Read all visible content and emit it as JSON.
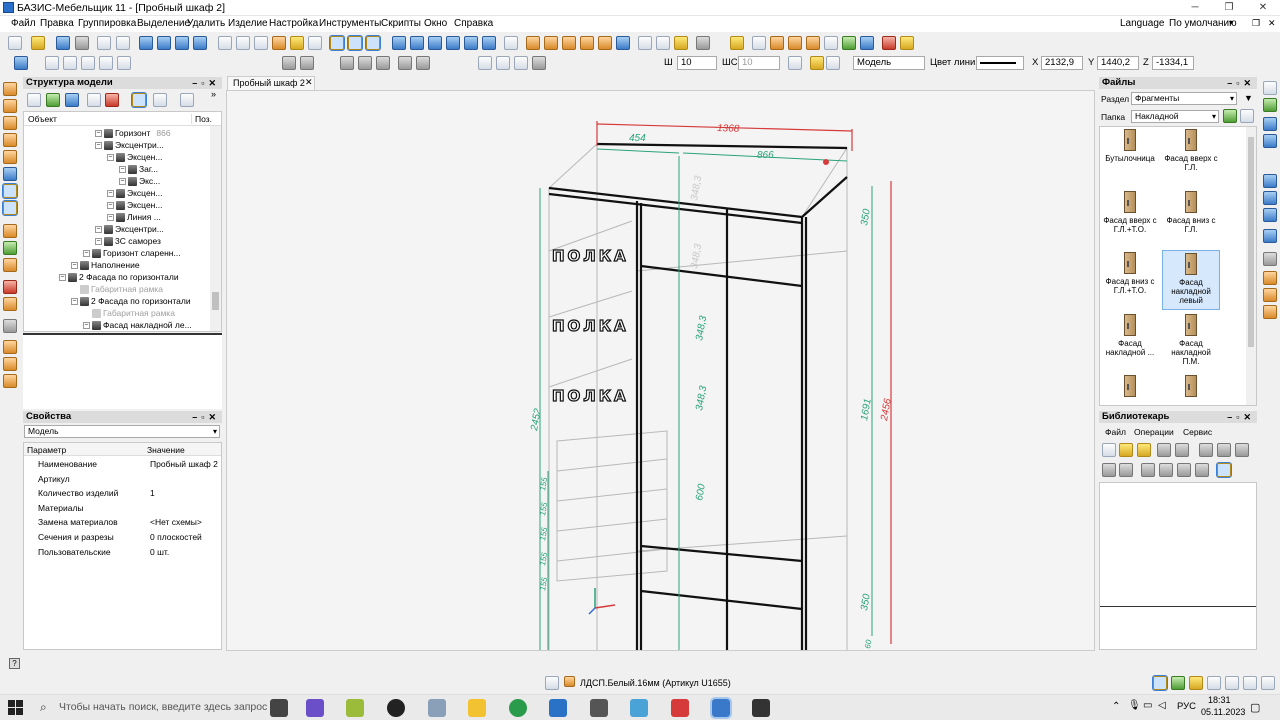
{
  "window": {
    "title": "БАЗИС-Мебельщик 11 - [Пробный шкаф 2]"
  },
  "menu": {
    "items": [
      "Файл",
      "Правка",
      "Группировка",
      "Выделение",
      "Удалить",
      "Изделие",
      "Настройка",
      "Инструменты",
      "Скрипты",
      "Окно",
      "Справка"
    ],
    "language": "Language",
    "default": "По умолчанию"
  },
  "toolbar": {
    "w_label": "Ш",
    "w_value": "10",
    "wc_label": "ШС",
    "wc_value": "10",
    "layer": "Модель",
    "line_color_label": "Цвет линии",
    "x_label": "X",
    "x_value": "2132,9",
    "y_label": "Y",
    "y_value": "1440,2",
    "z_label": "Z",
    "z_value": "-1334,1"
  },
  "structure": {
    "title": "Структура модели",
    "col_object": "Объект",
    "col_pos": "Поз.",
    "rows": [
      {
        "text": "Горизонт",
        "extra": "866",
        "indent": 3,
        "dim": false
      },
      {
        "text": "Эксцентри...",
        "indent": 3,
        "dim": false
      },
      {
        "text": "Эксцен...",
        "indent": 4,
        "dim": false
      },
      {
        "text": "Заг...",
        "indent": 5,
        "dim": false
      },
      {
        "text": "Экс...",
        "indent": 5,
        "dim": false
      },
      {
        "text": "Эксцен...",
        "indent": 4,
        "dim": false
      },
      {
        "text": "Эксцен...",
        "indent": 4,
        "dim": false
      },
      {
        "text": "Линия ...",
        "indent": 4,
        "dim": false
      },
      {
        "text": "Эксцентри...",
        "indent": 3,
        "dim": false
      },
      {
        "text": "3С саморез",
        "indent": 3,
        "dim": false
      },
      {
        "text": "Горизонт сларенн...",
        "indent": 2,
        "dim": false
      },
      {
        "text": "Наполнение",
        "indent": 1,
        "dim": false
      },
      {
        "text": "2 Фасада по горизонтали",
        "indent": 0,
        "dim": false
      },
      {
        "text": "Габаритная рамка",
        "indent": 1,
        "dim": true
      },
      {
        "text": "2 Фасада по горизонтали",
        "indent": 1,
        "dim": false
      },
      {
        "text": "Габаритная рамка",
        "indent": 2,
        "dim": true
      },
      {
        "text": "Фасад накладной ле...",
        "indent": 2,
        "dim": false
      }
    ]
  },
  "properties": {
    "title": "Свойства",
    "selector": "Модель",
    "col_param": "Параметр",
    "col_value": "Значение",
    "rows": [
      {
        "name": "Наименование",
        "value": "Пробный шкаф 2"
      },
      {
        "name": "Артикул",
        "value": ""
      },
      {
        "name": "Количество изделий",
        "value": "1"
      },
      {
        "name": "Материалы",
        "value": ""
      },
      {
        "name": "Замена материалов",
        "value": "<Нет схемы>"
      },
      {
        "name": "Сечения и разрезы",
        "value": "0 плоскостей"
      },
      {
        "name": "Пользовательские",
        "value": "0 шт."
      }
    ]
  },
  "document": {
    "tab": "Пробный шкаф 2"
  },
  "drawing": {
    "dims": [
      "1368",
      "454",
      "866",
      "2452",
      "2456",
      "1691",
      "350",
      "350",
      "348,3",
      "348,3",
      "600",
      "348,3",
      "348,3",
      "155",
      "155",
      "155",
      "155",
      "155",
      "60",
      "60"
    ],
    "shelf_label": "ПОЛКА"
  },
  "files": {
    "title": "Файлы",
    "section_label": "Раздел",
    "section_value": "Фрагменты",
    "folder_label": "Папка",
    "folder_value": "Накладной",
    "items": [
      {
        "label": "Бутылочница"
      },
      {
        "label": "Фасад вверх с Г.Л."
      },
      {
        "label": "Фасад вверх с Г.Л.+Т.О."
      },
      {
        "label": "Фасад вниз с Г.Л."
      },
      {
        "label": "Фасад вниз с Г.Л.+Т.О."
      },
      {
        "label": "Фасад накладной левый"
      },
      {
        "label": "Фасад накладной ..."
      },
      {
        "label": "Фасад накладной П.М."
      },
      {
        "label": ""
      },
      {
        "label": ""
      }
    ]
  },
  "librarian": {
    "title": "Библиотекарь",
    "menu": [
      "Файл",
      "Операции",
      "Сервис"
    ]
  },
  "status": {
    "material": "ЛДСП.Белый.16мм (Артикул U1655)"
  },
  "taskbar": {
    "search_placeholder": "Чтобы начать поиск, введите здесь запрос",
    "lang": "РУС",
    "time": "18:31",
    "date": "05.11.2023"
  }
}
